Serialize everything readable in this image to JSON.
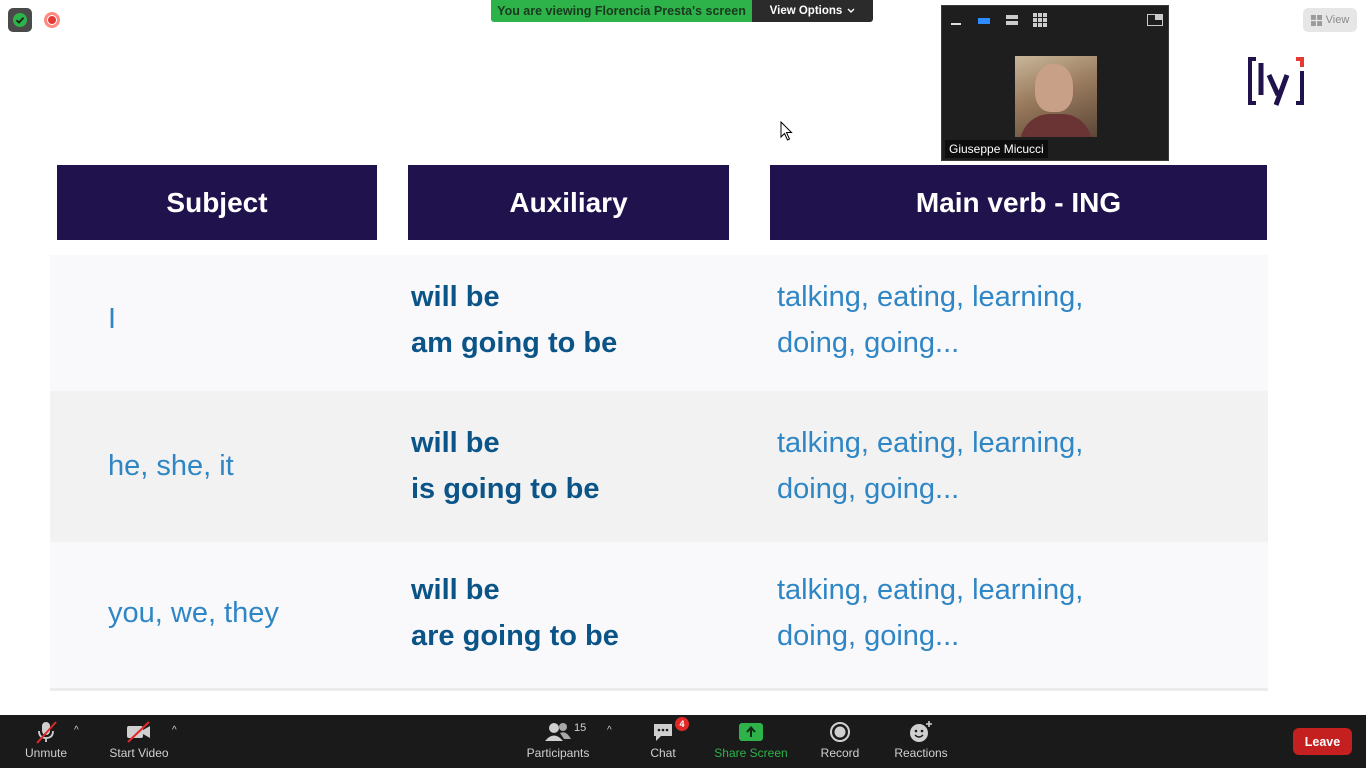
{
  "banner": {
    "viewing_text": "You are viewing Florencia Presta's screen",
    "view_options_label": "View Options"
  },
  "top_right": {
    "view_label": "View"
  },
  "video_panel": {
    "participant_name": "Giuseppe Micucci"
  },
  "logo": {
    "text": "[ly]"
  },
  "table": {
    "headers": [
      "Subject",
      "Auxiliary",
      "Main verb - ING"
    ],
    "rows": [
      {
        "subject": "I",
        "aux_line1": "will be",
        "aux_line2": "am going to be",
        "verb_line1": "talking, eating, learning,",
        "verb_line2": "doing, going..."
      },
      {
        "subject": "he, she, it",
        "aux_line1": "will be",
        "aux_line2": "is going to be",
        "verb_line1": "talking, eating, learning,",
        "verb_line2": "doing, going..."
      },
      {
        "subject": "you, we, they",
        "aux_line1": "will be",
        "aux_line2": "are going to be",
        "verb_line1": "talking, eating, learning,",
        "verb_line2": "doing, going..."
      }
    ]
  },
  "toolbar": {
    "unmute": "Unmute",
    "start_video": "Start Video",
    "participants": "Participants",
    "participants_count": "15",
    "chat": "Chat",
    "chat_badge": "4",
    "share_screen": "Share Screen",
    "record": "Record",
    "reactions": "Reactions",
    "leave": "Leave"
  },
  "colors": {
    "header_bg": "#20124d",
    "subject_text": "#2f86c5",
    "aux_text": "#0b5488",
    "share_green": "#2db34a",
    "leave_red": "#c4201f"
  }
}
